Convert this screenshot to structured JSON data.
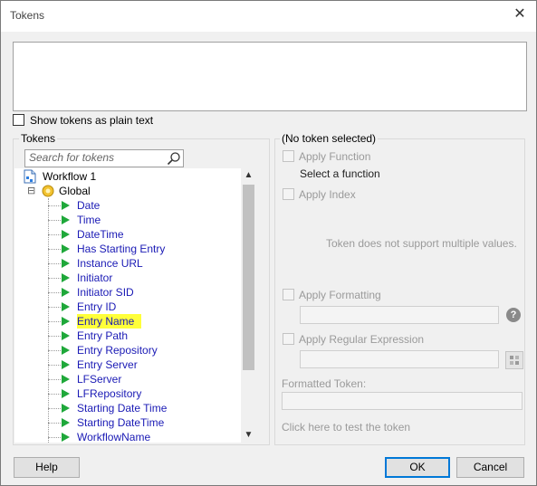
{
  "window": {
    "title": "Tokens",
    "close_glyph": "✕"
  },
  "editor": {
    "value": ""
  },
  "plain_text": {
    "label": "Show tokens as plain text",
    "checked": false
  },
  "tokens_panel": {
    "title": "Tokens",
    "search_placeholder": "Search for tokens",
    "tree": {
      "root": {
        "label": "Workflow 1",
        "icon": "workflow-icon"
      },
      "group": {
        "label": "Global",
        "icon": "global-folder-icon",
        "expander": "⊟"
      },
      "items": [
        {
          "label": "Date"
        },
        {
          "label": "Time"
        },
        {
          "label": "DateTime"
        },
        {
          "label": "Has Starting Entry"
        },
        {
          "label": "Instance URL"
        },
        {
          "label": "Initiator"
        },
        {
          "label": "Initiator SID"
        },
        {
          "label": "Entry ID"
        },
        {
          "label": "Entry Name",
          "highlighted": true
        },
        {
          "label": "Entry Path"
        },
        {
          "label": "Entry Repository"
        },
        {
          "label": "Entry Server"
        },
        {
          "label": "LFServer"
        },
        {
          "label": "LFRepository"
        },
        {
          "label": "Starting Date Time"
        },
        {
          "label": "Starting DateTime"
        },
        {
          "label": "WorkflowName"
        }
      ]
    },
    "scroll_up": "▲",
    "scroll_down": "▼"
  },
  "details_panel": {
    "title": "(No token selected)",
    "apply_function": {
      "label": "Apply Function",
      "hint": "Select a function"
    },
    "apply_index": {
      "label": "Apply Index"
    },
    "multi_values_note": "Token does not support multiple values.",
    "apply_formatting": {
      "label": "Apply Formatting"
    },
    "help_glyph": "?",
    "apply_regex": {
      "label": "Apply Regular Expression"
    },
    "formatted_token_label": "Formatted Token:",
    "test_link": "Click here to test the token"
  },
  "buttons": {
    "help": "Help",
    "ok": "OK",
    "cancel": "Cancel"
  },
  "colors": {
    "token_text": "#1a1ab5",
    "highlight": "#ffff3a",
    "token_arrow": "#1fa83a"
  }
}
